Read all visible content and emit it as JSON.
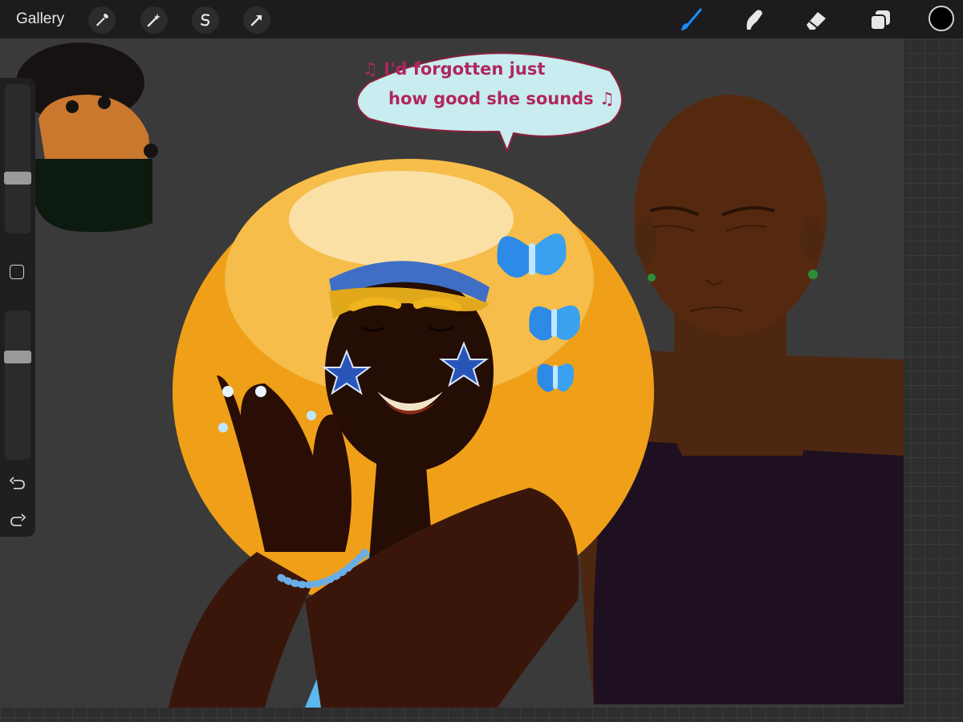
{
  "app": {
    "gallery_label": "Gallery"
  },
  "toolbar_left": [
    {
      "name": "actions",
      "icon": "wrench-icon"
    },
    {
      "name": "adjustments",
      "icon": "magic-wand-icon"
    },
    {
      "name": "selection",
      "icon": "selection-s-icon"
    },
    {
      "name": "transform",
      "icon": "arrow-cursor-icon"
    }
  ],
  "toolbar_right": [
    {
      "name": "brush",
      "icon": "brush-icon",
      "active": true
    },
    {
      "name": "smudge",
      "icon": "smudge-icon",
      "active": false
    },
    {
      "name": "eraser",
      "icon": "eraser-icon",
      "active": false
    },
    {
      "name": "layers",
      "icon": "layers-icon",
      "active": false
    }
  ],
  "current_color": "#000000",
  "accent_color": "#1a8cff",
  "sidebar": {
    "brush_size_level": 0.36,
    "opacity_level": 0.31,
    "undo_icon": "undo-icon",
    "redo_icon": "redo-icon"
  },
  "artwork": {
    "speech_bubble": {
      "line1": "♫ I'd forgotten just",
      "line2": "how good she sounds ♫"
    }
  }
}
